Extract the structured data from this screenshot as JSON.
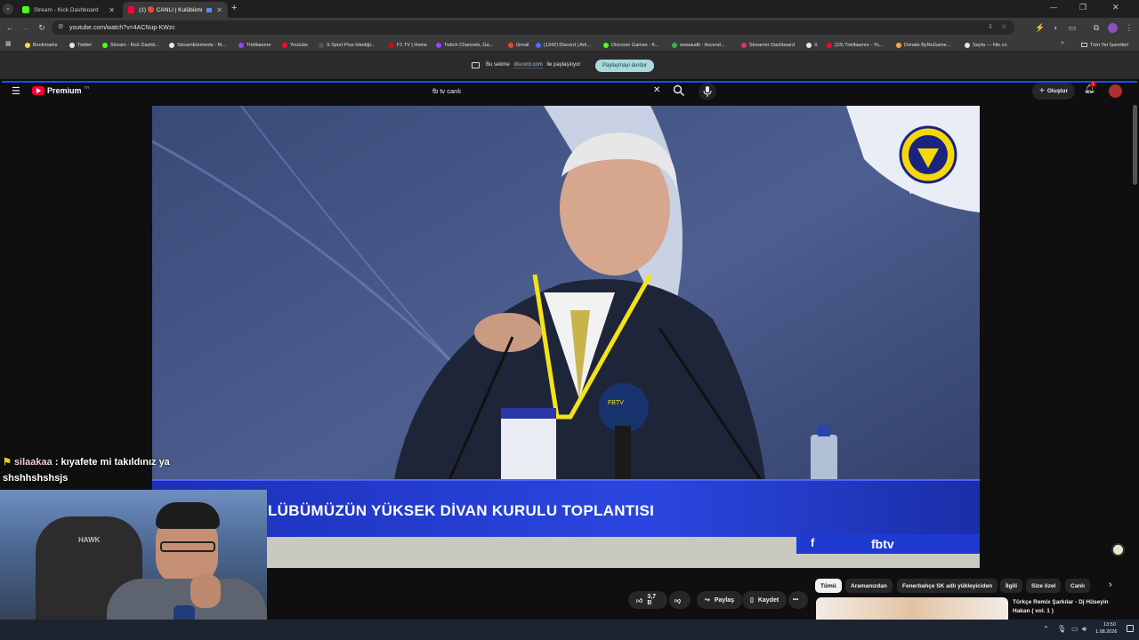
{
  "browser": {
    "tabs": [
      {
        "title": "Stream - Kick Dashboard",
        "active": false
      },
      {
        "title": "(1) 🔴 CANLI | Kulübümüzü",
        "active": true
      }
    ],
    "new_tab": "+",
    "url": "youtube.com/watch?v=4ACNup-KWzc",
    "bookmarks": [
      "Bookmarks",
      "Twitter",
      "Stream - Kick Dashb...",
      "StreamElements - M...",
      "Trielbaenre",
      "Youtube",
      "S Sport Plus-İstediği...",
      "F1 TV | Home",
      "Twitch Channels, Ga...",
      "Gmail",
      "(1342) Discord | Ark...",
      "Discover Games - K...",
      "wowaudit - Ascend...",
      "Streamer Dashboard",
      "X",
      "(23) Trielbaenre - Yo...",
      "Donate ByNoGame...",
      "Sayfa — hits.co"
    ],
    "all_bookmarks": "Tüm Yer İşaretleri",
    "overflow": "»"
  },
  "sharebar": {
    "prefix": "Bu sekme",
    "site": "discord.com",
    "suffix": "ile paylaşılıyor",
    "stop_button": "Paylaşmayı durdur"
  },
  "youtube": {
    "logo": "Premium",
    "logo_sup": "TR",
    "search_value": "fb tv canlı",
    "create_button": "Oluştur",
    "notification_count": "1",
    "video": {
      "banner_text": "LÜBÜMÜZÜN YÜKSEK DİVAN KURULU TOPLANTISI",
      "brand": "fbtv",
      "watermark": "YouTube",
      "mic_label": "FBTV"
    },
    "actions": {
      "likes": "3,7 B",
      "share": "Paylaş",
      "save": "Kaydet",
      "more": "•••"
    },
    "chips": [
      "Tümü",
      "Aramanızdan",
      "Fenerbahçe SK adlı yükleyiciden",
      "İlgili",
      "Size özel",
      "Canlı"
    ],
    "recommendation": {
      "title": "Türkçe Remix Şarkılar - Dj Hüseyin Hakan ( vol. 1 )"
    }
  },
  "overlay": {
    "chat_user": "silaakaa",
    "chat_message": " : kıyafete mi takıldınız ya shshhshshsjs",
    "chair_brand": "HAWK"
  },
  "taskbar": {
    "time": "13:50",
    "date": "1.08.2026"
  },
  "colors": {
    "yt_red": "#ff0033",
    "chip_active": "#f1f1f1",
    "share_pill": "#a8dadc",
    "banner_blue": "#2a3fd0"
  }
}
